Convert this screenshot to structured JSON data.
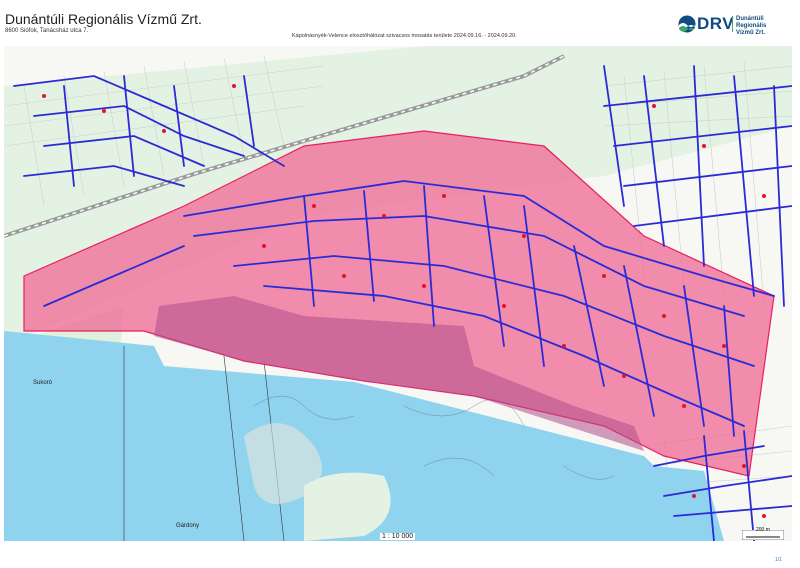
{
  "header": {
    "company": "Dunántúli Regionális Vízmű Zrt.",
    "address": "8600 Siófok, Tanácsház utca 7.",
    "title": "Kápolnásnyék-Velence elosztóhálózat szivacsos mosatás területe 2024.09.16. - 2024.09.20."
  },
  "logo": {
    "abbr": "DRV",
    "name_line1": "Dunántúli Regionális",
    "name_line2": "Vízmű Zrt.",
    "icon": "drv-wave-logo",
    "colors": {
      "blue": "#0f4c81",
      "green": "#3aa66b"
    }
  },
  "map": {
    "scale_ratio": "1 : 10 000",
    "scale_bar_label": "200 m",
    "place_labels": [
      "Sukoró",
      "Gárdony"
    ],
    "page_number": "1/1",
    "colors": {
      "area_fill": "#f06292",
      "area_stroke": "#e91e63",
      "water": "#8fd3ee",
      "pipe": "#2b2bd6",
      "green_land": "#d9efd9",
      "railway": "#b0b0b0"
    }
  }
}
